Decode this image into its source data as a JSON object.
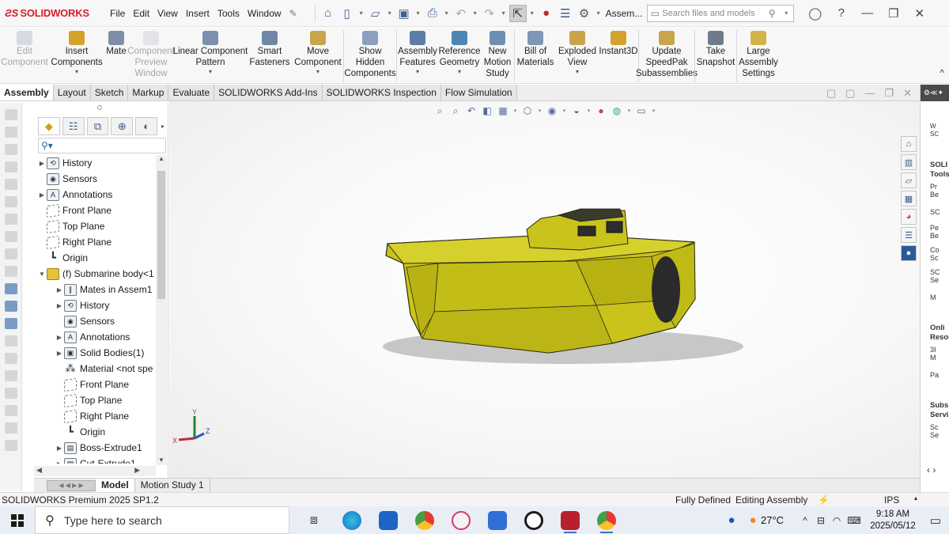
{
  "app": {
    "brand": "SOLIDWORKS",
    "doc_name": "Assem...",
    "search_placeholder": "Search files and models"
  },
  "menu": [
    "File",
    "Edit",
    "View",
    "Insert",
    "Tools",
    "Window"
  ],
  "commands": [
    {
      "label": "Edit\nComponent",
      "enabled": false
    },
    {
      "label": "Insert\nComponents",
      "enabled": true,
      "dropdown": true
    },
    {
      "label": "Mate",
      "enabled": true
    },
    {
      "label": "Component\nPreview\nWindow",
      "enabled": false
    },
    {
      "label": "Linear Component\nPattern",
      "enabled": true,
      "dropdown": true
    },
    {
      "label": "Smart\nFasteners",
      "enabled": true
    },
    {
      "label": "Move\nComponent",
      "enabled": true,
      "dropdown": true
    },
    {
      "label": "Show\nHidden\nComponents",
      "enabled": true
    },
    {
      "label": "Assembly\nFeatures",
      "enabled": true,
      "dropdown": true
    },
    {
      "label": "Reference\nGeometry",
      "enabled": true,
      "dropdown": true
    },
    {
      "label": "New\nMotion\nStudy",
      "enabled": true
    },
    {
      "label": "Bill of\nMaterials",
      "enabled": true
    },
    {
      "label": "Exploded\nView",
      "enabled": true,
      "dropdown": true
    },
    {
      "label": "Instant3D",
      "enabled": true
    },
    {
      "label": "Update\nSpeedPak\nSubassemblies",
      "enabled": true
    },
    {
      "label": "Take\nSnapshot",
      "enabled": true
    },
    {
      "label": "Large\nAssembly\nSettings",
      "enabled": true
    }
  ],
  "tabs": [
    "Assembly",
    "Layout",
    "Sketch",
    "Markup",
    "Evaluate",
    "SOLIDWORKS Add-Ins",
    "SOLIDWORKS Inspection",
    "Flow Simulation"
  ],
  "active_tab": "Assembly",
  "tree": [
    {
      "label": "History",
      "level": 0,
      "expandable": true
    },
    {
      "label": "Sensors",
      "level": 0,
      "expandable": false
    },
    {
      "label": "Annotations",
      "level": 0,
      "expandable": true
    },
    {
      "label": "Front Plane",
      "level": 0,
      "expandable": false
    },
    {
      "label": "Top Plane",
      "level": 0,
      "expandable": false
    },
    {
      "label": "Right Plane",
      "level": 0,
      "expandable": false
    },
    {
      "label": "Origin",
      "level": 0,
      "expandable": false
    },
    {
      "label": "(f) Submarine body<1",
      "level": 0,
      "expandable": true,
      "expanded": true
    },
    {
      "label": "Mates in Assem1",
      "level": 1,
      "expandable": true
    },
    {
      "label": "History",
      "level": 1,
      "expandable": true
    },
    {
      "label": "Sensors",
      "level": 1,
      "expandable": false
    },
    {
      "label": "Annotations",
      "level": 1,
      "expandable": true
    },
    {
      "label": "Solid Bodies(1)",
      "level": 1,
      "expandable": true
    },
    {
      "label": "Material <not spe",
      "level": 1,
      "expandable": false
    },
    {
      "label": "Front Plane",
      "level": 1,
      "expandable": false
    },
    {
      "label": "Top Plane",
      "level": 1,
      "expandable": false
    },
    {
      "label": "Right Plane",
      "level": 1,
      "expandable": false
    },
    {
      "label": "Origin",
      "level": 1,
      "expandable": false
    },
    {
      "label": "Boss-Extrude1",
      "level": 1,
      "expandable": true
    },
    {
      "label": "Cut-Extrude1",
      "level": 1,
      "expandable": true
    }
  ],
  "model_tabs": [
    "Model",
    "Motion Study 1"
  ],
  "status": {
    "product": "SOLIDWORKS Premium 2025 SP1.2",
    "definition": "Fully Defined",
    "mode": "Editing Assembly",
    "units": "IPS"
  },
  "triad": {
    "x": "X",
    "y": "Y",
    "z": "Z"
  },
  "task_pane": {
    "welcome": "W\nSC",
    "tools_title": "SOLI\nTools",
    "tools": [
      "Pr\nBe",
      "SC",
      "Pe\nBe",
      "Co\nSc",
      "SC\nSe",
      "M"
    ],
    "online_title": "Onli\nResou",
    "online": [
      "3I\nM",
      "Pa"
    ],
    "subs_title": "Subs\nServi",
    "subs": [
      "Sc\nSe"
    ]
  },
  "taskbar": {
    "search_placeholder": "Type here to search",
    "temperature": "27°C",
    "time": "9:18 AM",
    "date": "2025/05/12"
  },
  "colors": {
    "brand_red": "#d71e28",
    "model_yellow": "#c9c21a",
    "accent_blue": "#3c5f8f"
  }
}
